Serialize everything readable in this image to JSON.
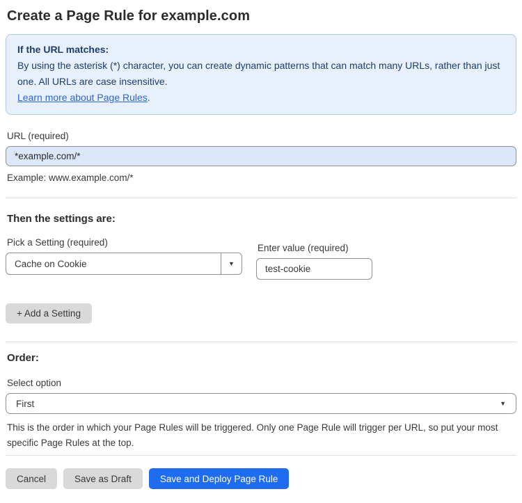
{
  "page": {
    "title": "Create a Page Rule for example.com"
  },
  "callout": {
    "heading": "If the URL matches:",
    "body": "By using the asterisk (*) character, you can create dynamic patterns that can match many URLs, rather than just one. All URLs are case insensitive.",
    "link_label": "Learn more about Page Rules",
    "link_suffix": "."
  },
  "url_field": {
    "label": "URL (required)",
    "value": "*example.com/*",
    "helper": "Example: www.example.com/*"
  },
  "settings": {
    "heading": "Then the settings are:",
    "setting_label": "Pick a Setting (required)",
    "setting_value": "Cache on Cookie",
    "value_label": "Enter value (required)",
    "value_value": "test-cookie",
    "add_button_label": "+ Add a Setting"
  },
  "order": {
    "heading": "Order:",
    "label": "Select option",
    "value": "First",
    "helper": "This is the order in which your Page Rules will be triggered. Only one Page Rule will trigger per URL, so put your most specific Page Rules at the top."
  },
  "footer": {
    "cancel_label": "Cancel",
    "save_draft_label": "Save as Draft",
    "save_deploy_label": "Save and Deploy Page Rule"
  },
  "icons": {
    "caret_down": "▼"
  },
  "colors": {
    "callout_bg": "#e8f1fb",
    "callout_border": "#a9c9ee",
    "callout_text": "#1e3c6e",
    "link": "#2c64d8",
    "url_input_bg": "#dce8fa",
    "primary_button": "#1f6cf1",
    "gray_button": "#d9d9d9"
  }
}
